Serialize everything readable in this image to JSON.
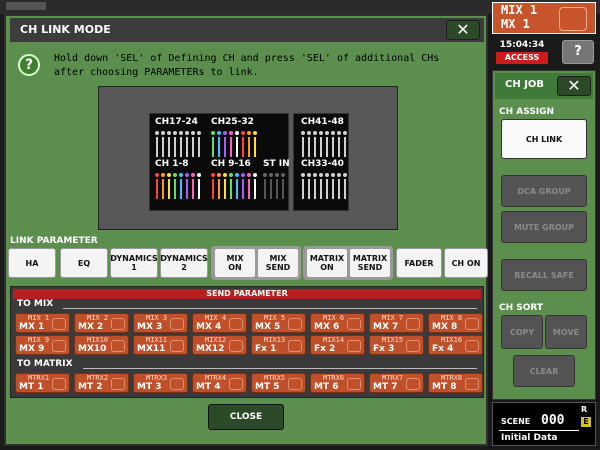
{
  "dialog": {
    "title": "CH LINK MODE",
    "close_label": "✕",
    "help_icon": "question-icon",
    "instruction": "Hold down 'SEL' of Defining CH and press 'SEL' of additional CHs\nafter choosing PARAMETERs to link.",
    "channel_groups": [
      "CH17-24",
      "CH25-32",
      "CH41-48",
      "CH 1-8",
      "CH 9-16",
      "ST IN",
      "CH33-40"
    ],
    "link_parameter_label": "LINK PARAMETER",
    "link_parameters": [
      "HA",
      "EQ",
      "DYNAMICS\n1",
      "DYNAMICS\n2",
      "MIX\nON",
      "MIX\nSEND",
      "MATRIX\nON",
      "MATRIX\nSEND",
      "FADER",
      "CH ON"
    ],
    "send_parameter_label": "SEND PARAMETER",
    "to_mix_label": "TO MIX",
    "to_matrix_label": "TO MATRIX",
    "mix_sends": [
      {
        "top": "MIX 1",
        "bottom": "MX 1"
      },
      {
        "top": "MIX 2",
        "bottom": "MX 2"
      },
      {
        "top": "MIX 3",
        "bottom": "MX 3"
      },
      {
        "top": "MIX 4",
        "bottom": "MX 4"
      },
      {
        "top": "MIX 5",
        "bottom": "MX 5"
      },
      {
        "top": "MIX 6",
        "bottom": "MX 6"
      },
      {
        "top": "MIX 7",
        "bottom": "MX 7"
      },
      {
        "top": "MIX 8",
        "bottom": "MX 8"
      },
      {
        "top": "MIX 9",
        "bottom": "MX 9"
      },
      {
        "top": "MIX10",
        "bottom": "MX10"
      },
      {
        "top": "MIX11",
        "bottom": "MX11"
      },
      {
        "top": "MIX12",
        "bottom": "MX12"
      },
      {
        "top": "MIX13",
        "bottom": "Fx 1"
      },
      {
        "top": "MIX14",
        "bottom": "Fx 2"
      },
      {
        "top": "MIX15",
        "bottom": "Fx 3"
      },
      {
        "top": "MIX16",
        "bottom": "Fx 4"
      }
    ],
    "matrix_sends": [
      {
        "top": "MTRX1",
        "bottom": "MT 1"
      },
      {
        "top": "MTRX2",
        "bottom": "MT 2"
      },
      {
        "top": "MTRX3",
        "bottom": "MT 3"
      },
      {
        "top": "MTRX4",
        "bottom": "MT 4"
      },
      {
        "top": "MTRX5",
        "bottom": "MT 5"
      },
      {
        "top": "MTRX6",
        "bottom": "MT 6"
      },
      {
        "top": "MTRX7",
        "bottom": "MT 7"
      },
      {
        "top": "MTRX8",
        "bottom": "MT 8"
      }
    ],
    "close_button": "CLOSE"
  },
  "status": {
    "mix_title_line1": "MIX 1",
    "mix_title_line2": "MX 1",
    "time": "15:04:34",
    "access": "ACCESS",
    "help": "?"
  },
  "ch_job": {
    "title": "CH JOB",
    "close_label": "✕",
    "assign_label": "CH ASSIGN",
    "ch_link": "CH LINK",
    "dca_group": "DCA GROUP",
    "mute_group": "MUTE GROUP",
    "recall_safe": "RECALL SAFE",
    "sort_label": "CH SORT",
    "copy": "COPY",
    "move": "MOVE",
    "clear": "CLEAR"
  },
  "scene": {
    "label": "SCENE",
    "number": "000",
    "r": "R",
    "e": "E",
    "name": "Initial Data"
  },
  "colors": {
    "panel_green": "#5c8f4e",
    "send_orange": "#c0502a",
    "send_header": "#b32020",
    "access_red": "#cc1c1c"
  }
}
